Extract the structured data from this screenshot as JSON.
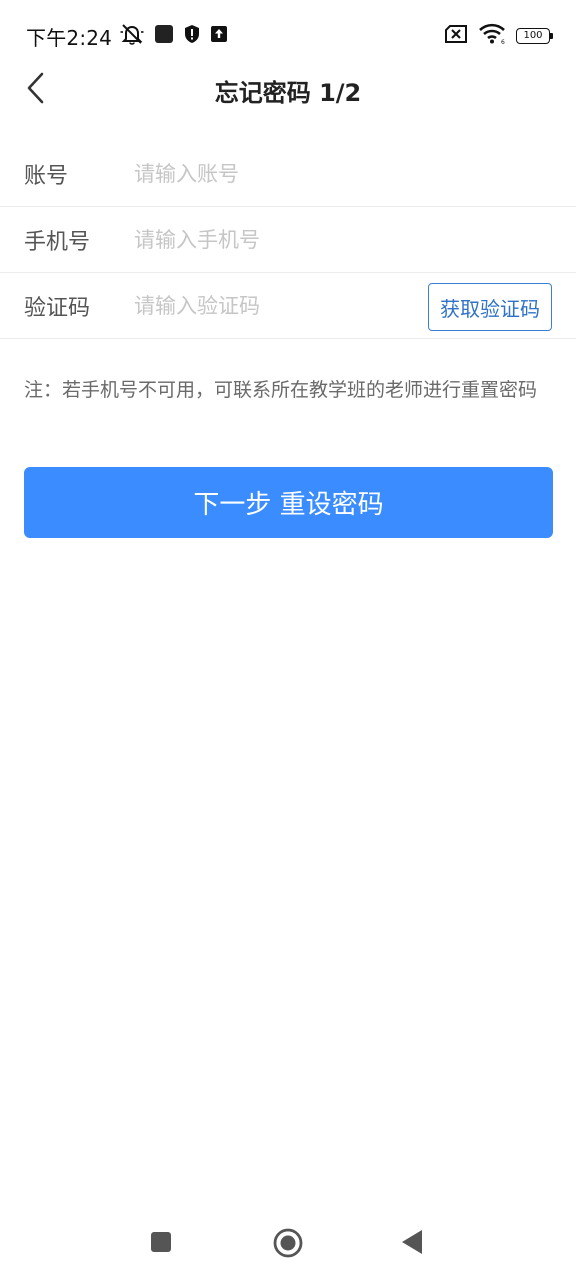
{
  "status_bar": {
    "time": "下午2:24",
    "battery": "100",
    "icons": [
      "mute-icon",
      "app-notification-icon",
      "shield-icon",
      "upload-icon",
      "sim-no-signal-icon",
      "wifi-icon",
      "battery-icon"
    ]
  },
  "header": {
    "title": "忘记密码 1/2",
    "back_icon": "chevron-left-icon"
  },
  "form": {
    "account": {
      "label": "账号",
      "placeholder": "请输入账号",
      "value": ""
    },
    "phone": {
      "label": "手机号",
      "placeholder": "请输入手机号",
      "value": ""
    },
    "code": {
      "label": "验证码",
      "placeholder": "请输入验证码",
      "value": ""
    },
    "get_code_label": "获取验证码"
  },
  "note": "注：若手机号不可用，可联系所在教学班的老师进行重置密码",
  "next_button": "下一步 重设密码",
  "nav_bar": {
    "icons": [
      "recent-apps-icon",
      "home-icon",
      "back-icon"
    ]
  },
  "colors": {
    "primary": "#3a8cff",
    "code_button_border": "#3a7fd5",
    "placeholder": "#c6c6c6"
  }
}
